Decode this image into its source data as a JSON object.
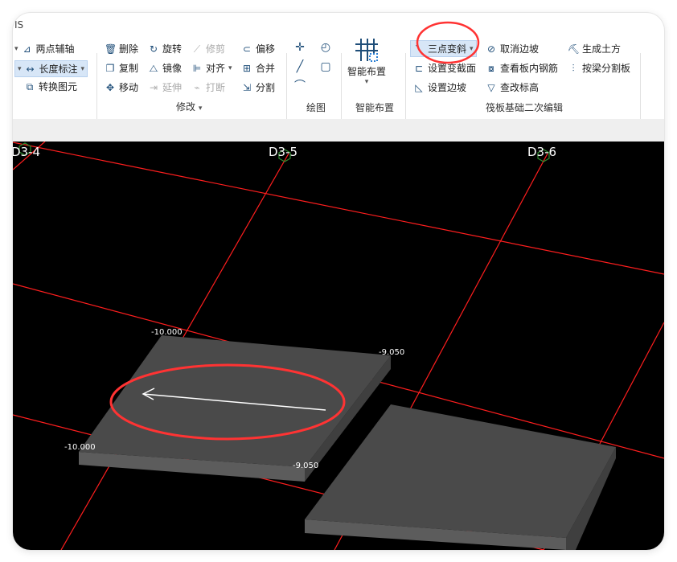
{
  "app": {
    "title": "IS"
  },
  "ribbon": {
    "left": {
      "two_point_axis": "两点辅轴",
      "length_dimension": "长度标注",
      "convert_element": "转换图元"
    },
    "modify": {
      "label": "修改",
      "delete": "删除",
      "rotate": "旋转",
      "trim": "修剪",
      "offset": "偏移",
      "copy": "复制",
      "mirror": "镜像",
      "align": "对齐",
      "merge": "合并",
      "move": "移动",
      "extend": "延伸",
      "break": "打断",
      "split": "分割"
    },
    "draw": {
      "label": "绘图"
    },
    "smart_layout": {
      "button_label": "智能布置",
      "group_label": "智能布置"
    },
    "raft_edit": {
      "label": "筏板基础二次编辑",
      "three_point_slope": "三点变斜",
      "set_variable_section": "设置变截面",
      "set_edge_slope": "设置边坡",
      "cancel_edge_slope": "取消边坡",
      "view_inner_rebar": "查看板内钢筋",
      "view_edit_elevation": "查改标高",
      "generate_earthwork": "生成土方",
      "split_by_beam": "按梁分割板"
    }
  },
  "canvas": {
    "axis_labels": [
      "D3-4",
      "D3-5",
      "D3-6"
    ],
    "elevations": [
      "-10.000",
      "-9.050",
      "-10.000",
      "-9.050"
    ]
  },
  "colors": {
    "grid": "#ff1e1e",
    "annotation": "#ff3333",
    "canvas_bg": "#000000",
    "slab_top": "#4a4a4a",
    "slab_side": "#5c5c5c",
    "axis_badge": "#2e8b2e"
  }
}
